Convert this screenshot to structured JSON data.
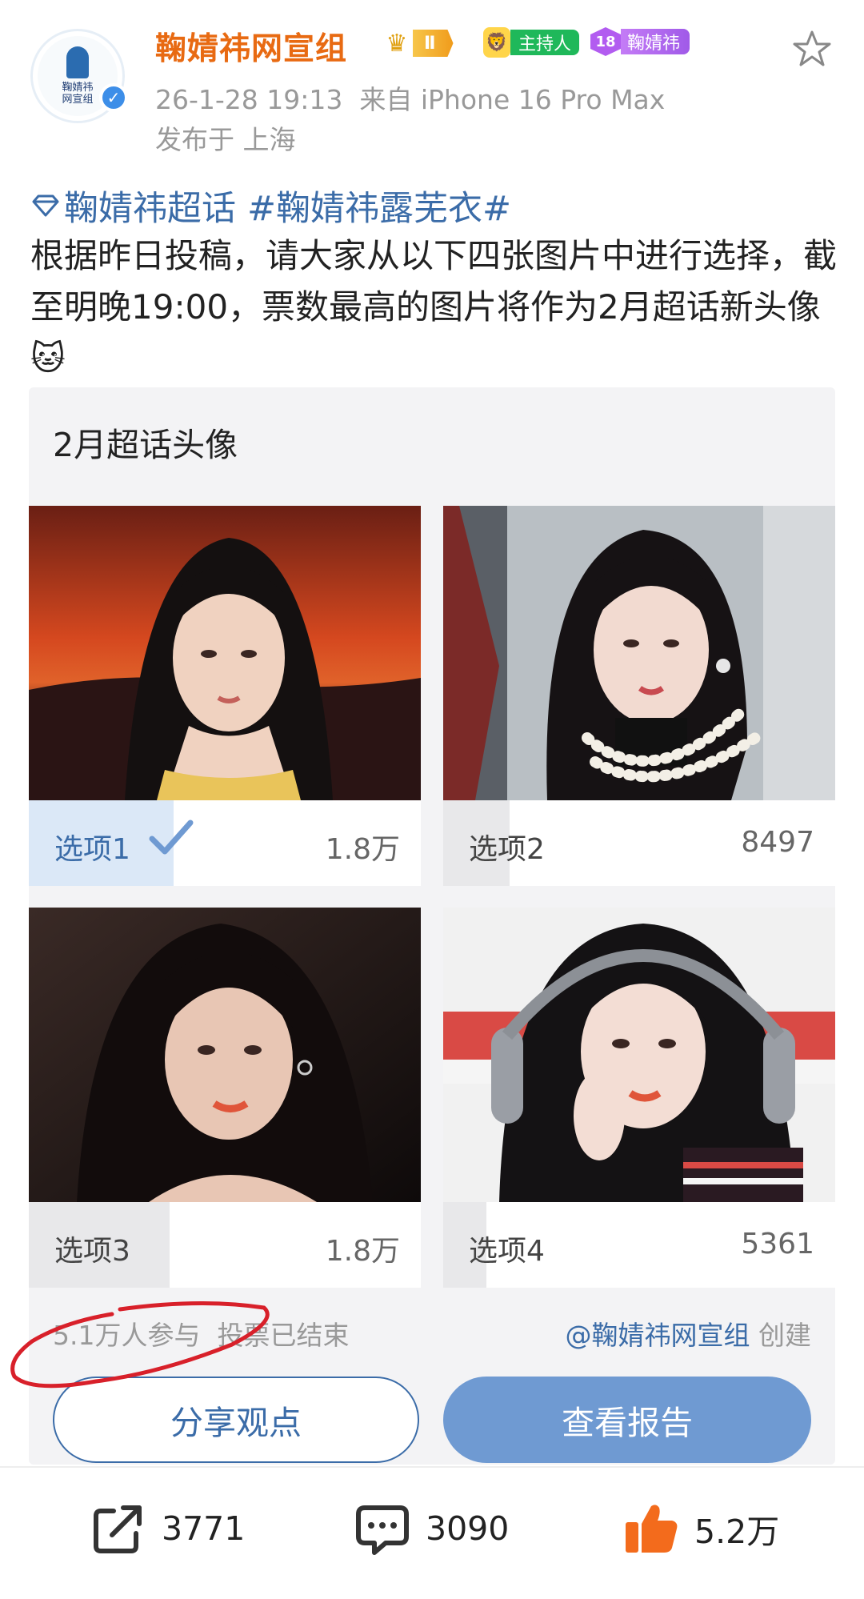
{
  "author": {
    "name": "鞠婧祎网宣组",
    "avatar_text": "鞠婧祎\n网宣组",
    "level_badge": "Ⅱ",
    "host_badge": "主持人",
    "fan_level": "18",
    "fan_badge": "鞠婧祎",
    "timestamp": "26-1-28 19:13",
    "source": "来自 iPhone 16 Pro Max",
    "location": "发布于 上海"
  },
  "post": {
    "topic_super": "鞠婧祎超话",
    "topic_hashtag": "#鞠婧祎露芜衣#",
    "body": "根据昨日投稿，请大家从以下四张图片中进行选择，截至明晚19:00，票数最高的图片将作为2月超话新头像🐱"
  },
  "poll": {
    "title": "2月超话头像",
    "options": [
      {
        "label": "选项1",
        "count": "1.8万",
        "share": 0.37,
        "selected": true
      },
      {
        "label": "选项2",
        "count": "8497",
        "share": 0.17,
        "selected": false
      },
      {
        "label": "选项3",
        "count": "1.8万",
        "share": 0.36,
        "selected": false
      },
      {
        "label": "选项4",
        "count": "5361",
        "share": 0.11,
        "selected": false
      }
    ],
    "participants": "5.1万人参与",
    "status": "投票已结束",
    "creator": "@鞠婧祎网宣组",
    "creator_suffix": "创建",
    "share_button": "分享观点",
    "report_button": "查看报告"
  },
  "actions": {
    "reposts": "3771",
    "comments": "3090",
    "likes": "5.2万"
  },
  "colors": {
    "author_name": "#e86a12",
    "link_blue": "#3b6ca8",
    "report_button_bg": "#6f9ad2",
    "annotation_red": "#d8202a",
    "like_orange": "#f36b1c"
  }
}
